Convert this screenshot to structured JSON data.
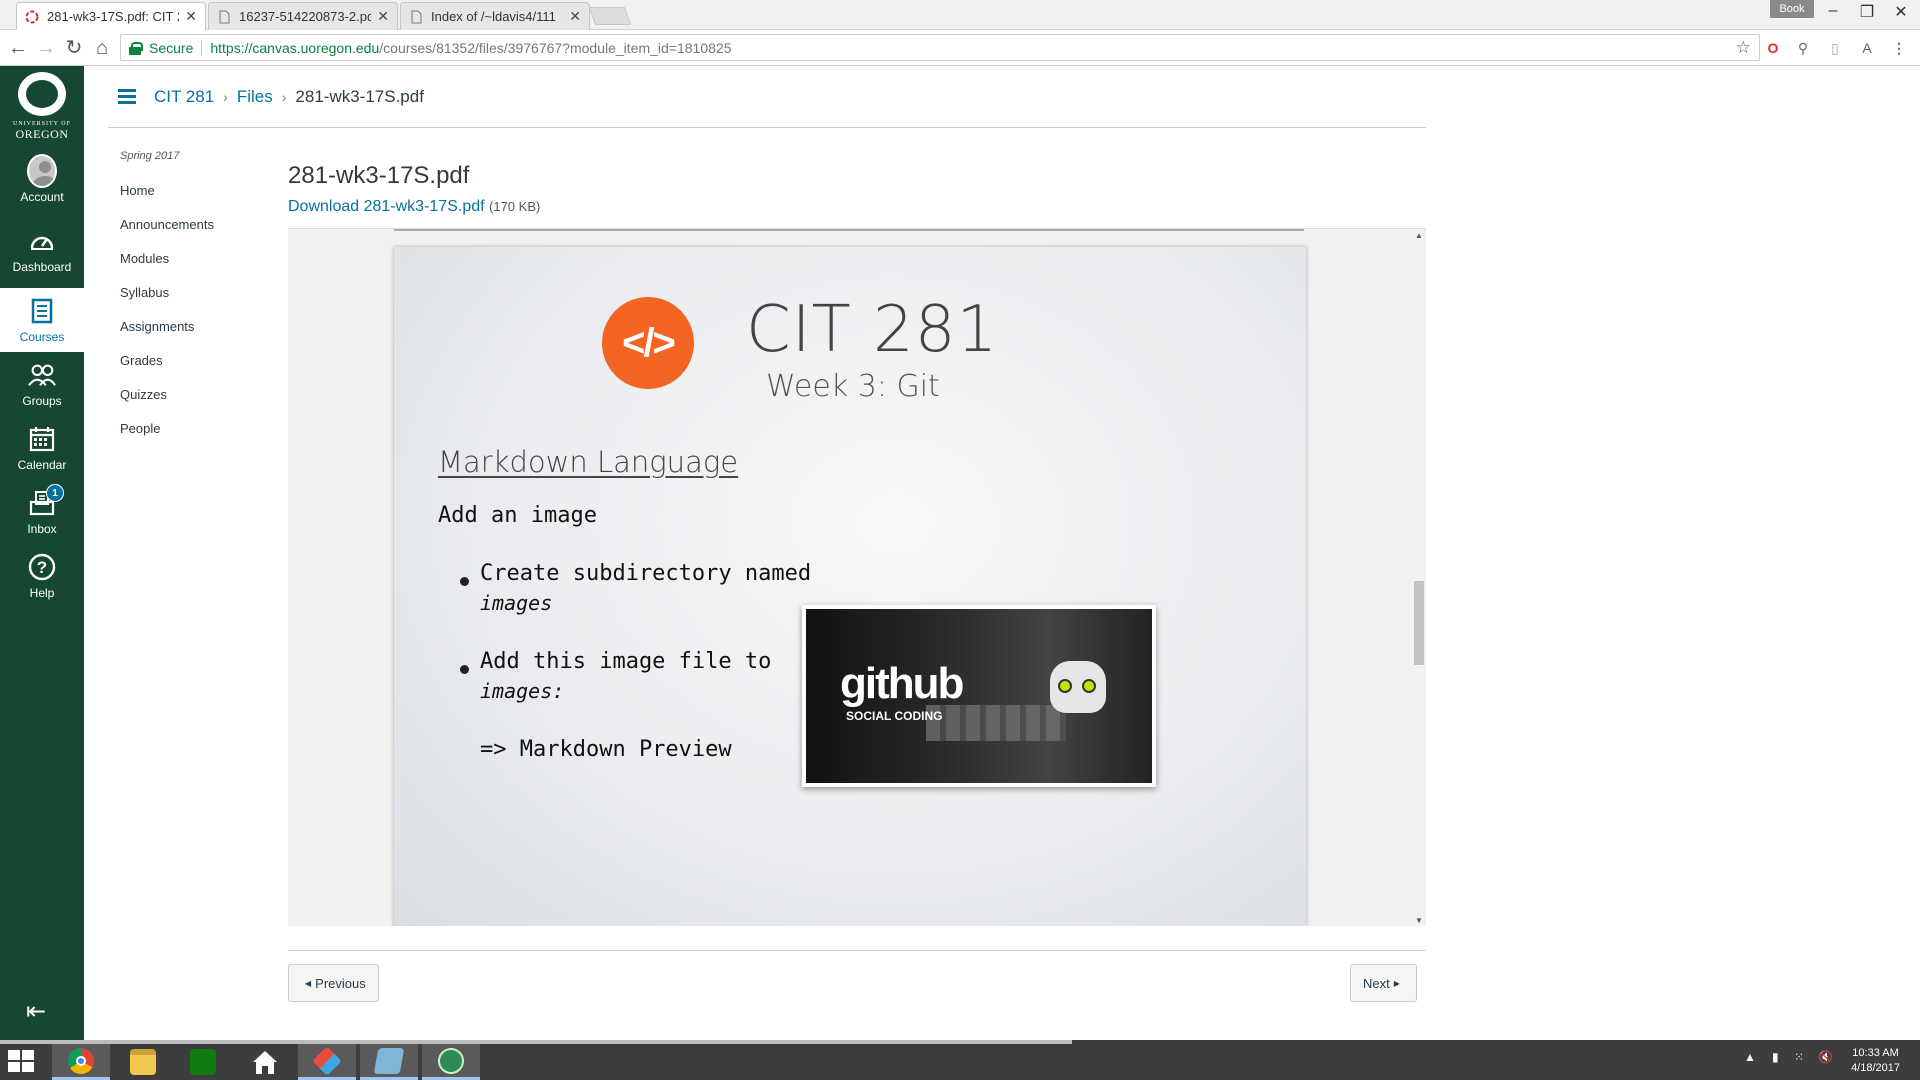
{
  "browser": {
    "tabs": [
      {
        "title": "281-wk3-17S.pdf: CIT 28",
        "active": true
      },
      {
        "title": "16237-514220873-2.pdf",
        "active": false
      },
      {
        "title": "Index of /~ldavis4/111",
        "active": false
      }
    ],
    "profile_badge": "Book",
    "secure_label": "Secure",
    "url_host": "https://canvas.uoregon.edu",
    "url_path": "/courses/81352/files/3976767?module_item_id=1810825"
  },
  "global_nav": {
    "logo_university": "UNIVERSITY OF",
    "logo_name": "OREGON",
    "items": [
      {
        "label": "Account",
        "icon": "avatar-icon"
      },
      {
        "label": "Dashboard",
        "icon": "dashboard-icon"
      },
      {
        "label": "Courses",
        "icon": "courses-icon",
        "active": true
      },
      {
        "label": "Groups",
        "icon": "groups-icon"
      },
      {
        "label": "Calendar",
        "icon": "calendar-icon"
      },
      {
        "label": "Inbox",
        "icon": "inbox-icon",
        "badge": "1"
      },
      {
        "label": "Help",
        "icon": "help-icon"
      }
    ]
  },
  "breadcrumb": {
    "course": "CIT 281",
    "section": "Files",
    "current": "281-wk3-17S.pdf"
  },
  "course_nav": {
    "term": "Spring 2017",
    "items": [
      "Home",
      "Announcements",
      "Modules",
      "Syllabus",
      "Assignments",
      "Grades",
      "Quizzes",
      "People"
    ]
  },
  "file": {
    "title": "281-wk3-17S.pdf",
    "download_label": "Download 281-wk3-17S.pdf",
    "size": "(170 KB)"
  },
  "slide": {
    "logo_text": "</>",
    "title": "CIT 281",
    "subtitle": "Week 3:  Git",
    "heading": "Markdown Language",
    "intro": "Add an image",
    "bullet1_line1": "Create subdirectory named",
    "bullet1_line2": "images",
    "bullet2_line1": "Add this image file to",
    "bullet2_line2": "images:",
    "arrow_line": "=> Markdown Preview",
    "image_word": "github",
    "image_sub": "SOCIAL CODING"
  },
  "pager": {
    "previous": "Previous",
    "next": "Next"
  },
  "taskbar": {
    "time": "10:33 AM",
    "date": "4/18/2017"
  },
  "colors": {
    "nav_green": "#154733",
    "link_blue": "#0770a3",
    "code_logo_orange": "#f26522"
  }
}
